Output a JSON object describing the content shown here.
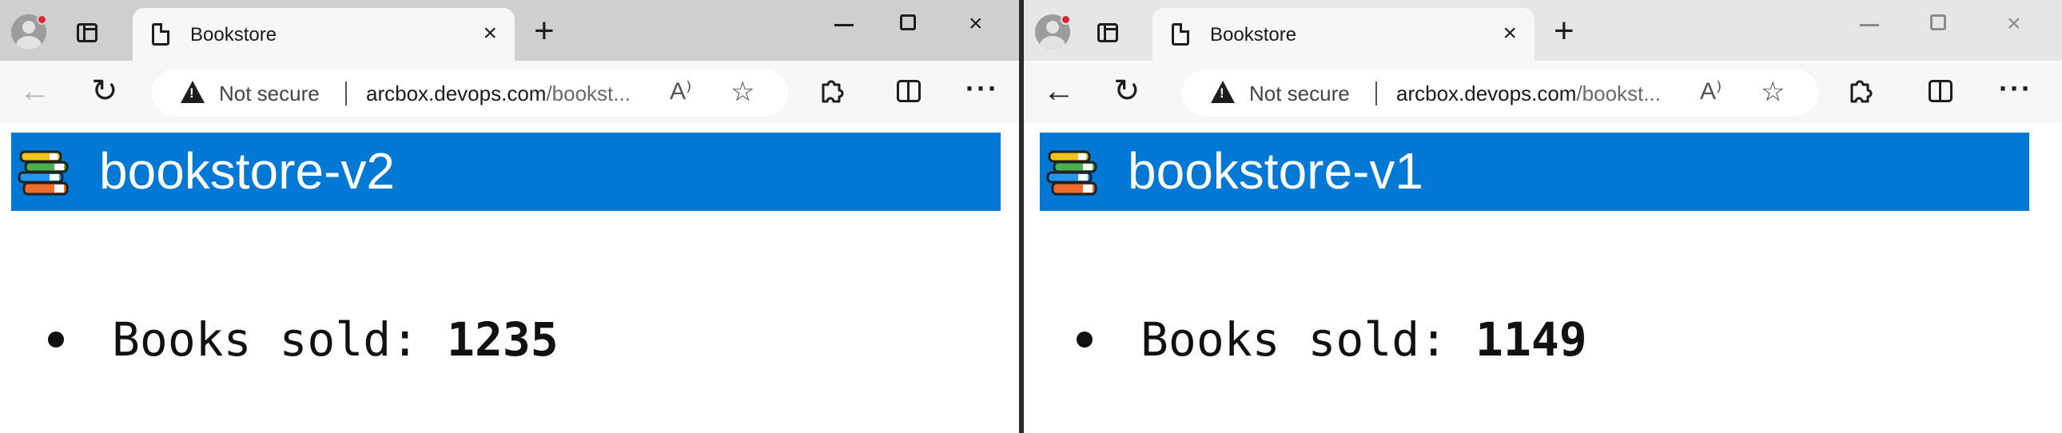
{
  "windows": [
    {
      "tab": {
        "title": "Bookstore"
      },
      "address": {
        "security": "Not secure",
        "url_host": "arcbox.devops.com",
        "url_path": "/bookst..."
      },
      "page": {
        "title": "bookstore-v2",
        "stat_label": "Books sold:",
        "stat_value": "1235"
      }
    },
    {
      "tab": {
        "title": "Bookstore"
      },
      "address": {
        "security": "Not secure",
        "url_host": "arcbox.devops.com",
        "url_path": "/bookst..."
      },
      "page": {
        "title": "bookstore-v1",
        "stat_label": "Books sold:",
        "stat_value": "1149"
      }
    }
  ],
  "icons": {
    "new_tab": "+",
    "close": "×",
    "back": "←",
    "refresh": "↻",
    "read_aloud": "A⁾",
    "favorite": "☆",
    "extensions": "puzzle",
    "more": "···"
  },
  "colors": {
    "header_blue": "#0078d4",
    "left_tabstrip": "#cfcfcf",
    "right_tabstrip": "#e6e6e6",
    "toolbar": "#f7f7f7"
  }
}
